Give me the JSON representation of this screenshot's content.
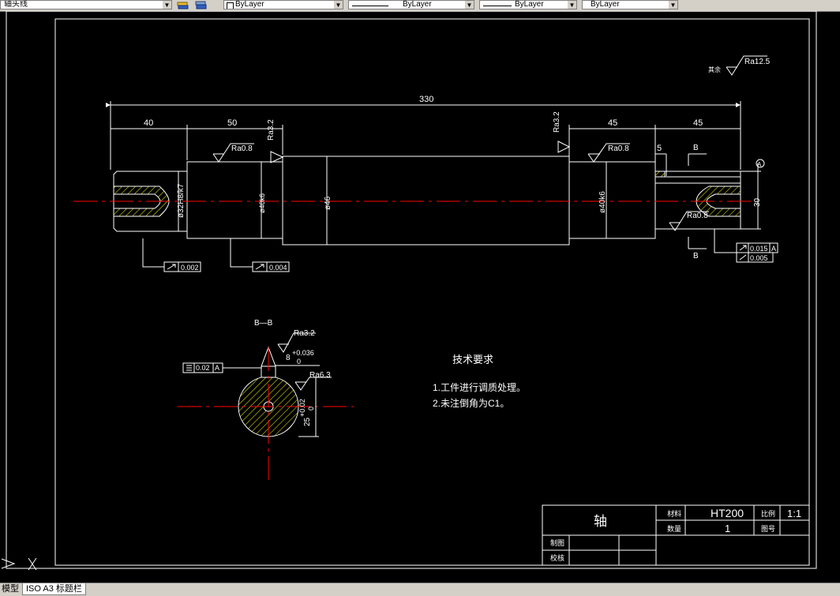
{
  "toolbar": {
    "layer_name": "轴头线",
    "color": "ByLayer",
    "linetype": "ByLayer",
    "lineweight": "ByLayer",
    "plotstyle": "ByLayer"
  },
  "drawing": {
    "dim_330": "330",
    "dim_40": "40",
    "dim_50": "50",
    "dim_45_a": "45",
    "dim_45_b": "45",
    "dim_5": "5",
    "dim_30": "30",
    "dia_left": "ø32H8/k7",
    "dia_40k6_left": "ø40k6",
    "dia_46": "ø46",
    "dia_40k6_right": "ø40k6",
    "rough_08_a": "Ra0.8",
    "rough_08_b": "Ra0.8",
    "rough_08_c": "Ra0.8",
    "rough_32_a": "Ra3.2",
    "rough_32_b": "Ra3.2",
    "rough_125": "Ra12.5",
    "rough_rest_label": "其余",
    "section_mark": "B",
    "datum": "A",
    "tol_runout_1": "0.002",
    "tol_runout_2": "0.004",
    "tol_runout_3": "0.015",
    "tol_runout_3_ref": "A",
    "tol_runout_4": "0.005",
    "section_title": "B—B",
    "section_rough_32": "Ra3.2",
    "section_rough_63": "Ra6.3",
    "key_width": "8",
    "key_tol_upper": "+0.036",
    "key_tol_lower": "0",
    "sym_tol": "0.02",
    "sym_tol_ref": "A",
    "depth": "25",
    "depth_tol_upper": "+0.02",
    "depth_tol_lower": "0",
    "tech_title": "技术要求",
    "tech_1": "1.工件进行调质处理。",
    "tech_2": "2.未注倒角为C1。"
  },
  "title_block": {
    "part_name": "轴",
    "material_label": "材料",
    "material": "HT200",
    "scale_label": "比例",
    "scale": "1:1",
    "qty_label": "数量",
    "qty": "1",
    "drawing_no_label": "图号",
    "drawn_label": "制图",
    "checked_label": "校核"
  },
  "tabs": {
    "model": "模型",
    "layout": "ISO A3 标题栏"
  },
  "colors": {
    "background": "#000000",
    "lines": "#ffffff",
    "centerline": "#ff0000",
    "hatch": "#ffff00"
  }
}
